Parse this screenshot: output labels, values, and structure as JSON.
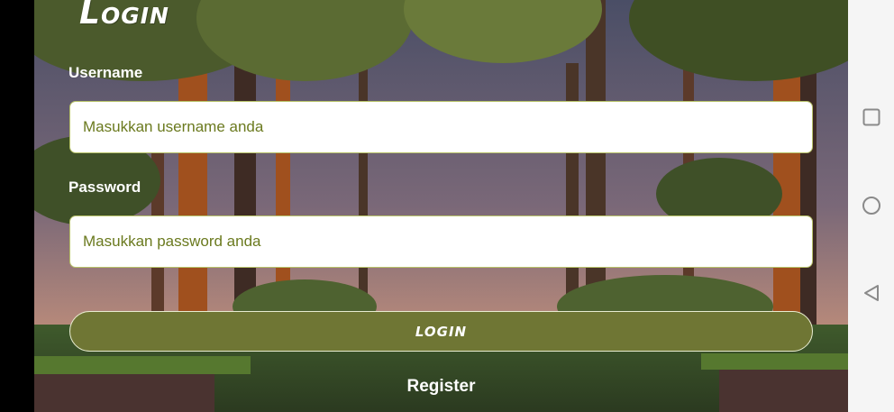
{
  "app": {
    "title": "Login",
    "username": {
      "label": "Username",
      "placeholder": "Masukkan username anda",
      "value": ""
    },
    "password": {
      "label": "Password",
      "placeholder": "Masukkan password anda",
      "value": ""
    },
    "login_button": "LOGIN",
    "register_link": "Register"
  },
  "navbar": {
    "buttons": [
      {
        "icon": "square-recents-icon"
      },
      {
        "icon": "circle-home-icon"
      },
      {
        "icon": "triangle-back-icon"
      }
    ]
  },
  "colors": {
    "accent": "#6f7634",
    "placeholder": "#6b7a1f",
    "field_border": "#b8c36a"
  }
}
